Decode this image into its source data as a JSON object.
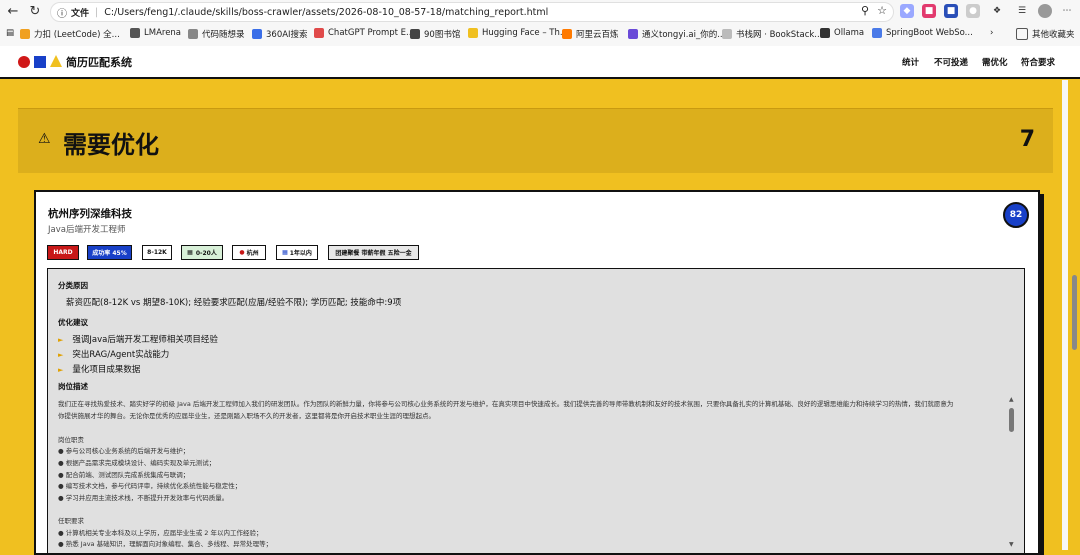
{
  "browser": {
    "scheme": "文件",
    "url": "C:/Users/feng1/.claude/skills/boss-crawler/assets/2026-08-10_08-57-18/matching_report.html",
    "bookmarks": [
      "力扣 (LeetCode) 全...",
      "LMArena",
      "代码随想录",
      "360AI搜索",
      "ChatGPT Prompt E...",
      "90图书馆",
      "Hugging Face – Th...",
      "阿里云百炼",
      "通义tongyi.ai_你的...",
      "书栈网 · BookStack...",
      "Ollama",
      "SpringBoot WebSo..."
    ],
    "other_bookmarks": "其他收藏夹"
  },
  "app": {
    "brand": "简历匹配系统",
    "nav": [
      "统计",
      "不可投递",
      "需优化",
      "符合要求"
    ]
  },
  "section": {
    "title": "需要优化",
    "count": "7"
  },
  "job": {
    "company": "杭州序列深维科技",
    "title": "Java后端开发工程师",
    "score": "82",
    "tags": [
      "HARD",
      "成功率 45%",
      "8-12K",
      "0-20人",
      "杭州",
      "1年以内",
      "团建聚餐 带薪年假 五险一金"
    ],
    "reason_heading": "分类原因",
    "reason": "薪资匹配(8-12K vs 期望8-10K); 经验要求匹配(应届/经验不限); 学历匹配; 技能命中:9项",
    "suggestions_heading": "优化建议",
    "suggestions": [
      "强调Java后端开发工程师相关项目经验",
      "突出RAG/Agent实战能力",
      "量化项目成果数据"
    ],
    "description_heading": "岗位描述",
    "description": [
      "我们正在寻找热爱技术、踏实好学的初级 Java 后端开发工程师加入我们的研发团队。作为团队的新鲜力量，你将参与公司核心业务系统的开发与维护，在真实项目中快速成长。我们提供完善的导师带教机制和友好的技术氛围，只要你具备扎实的计算机基础、良好的逻辑思维能力和持续学习的热情，我们就愿意为",
      "你提供施展才华的舞台。无论你是优秀的应届毕业生，还是刚踏入职场不久的开发者，这里都将是你开启技术职业生涯的理想起点。",
      "",
      "岗位职责",
      "● 参与公司核心业务系统的后端开发与维护；",
      "● 根据产品需求完成模块设计、编码实现及单元测试；",
      "● 配合前端、测试团队完成系统集成与联调；",
      "● 编写技术文档，参与代码评审，持续优化系统性能与稳定性；",
      "● 学习并应用主流技术栈，不断提升开发效率与代码质量。",
      "",
      "任职要求",
      "● 计算机相关专业本科及以上学历，应届毕业生或 2 年以内工作经验；",
      "● 熟悉 Java 基础知识，理解面向对象编程、集合、多线程、异常处理等；"
    ]
  }
}
